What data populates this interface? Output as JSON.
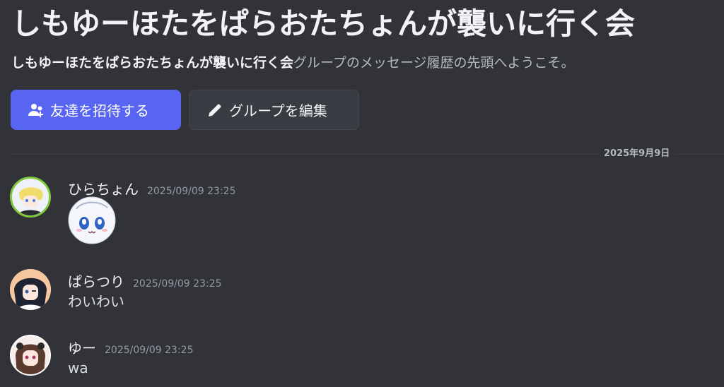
{
  "header": {
    "title": "しもゆーほたをぱらおたちょんが襲いに行く会",
    "subtitle_bold": "しもゆーほたをぱらおたちょんが襲いに行く会",
    "subtitle_rest": "グループのメッセージ履歴の先頭へようこそ。"
  },
  "actions": {
    "invite_label": "友達を招待する",
    "edit_label": "グループを編集"
  },
  "divider": {
    "date": "2025年9月9日"
  },
  "messages": [
    {
      "username": "ひらちょん",
      "timestamp": "2025/09/09 23:25",
      "text": ""
    },
    {
      "username": "ぱらつり",
      "timestamp": "2025/09/09 23:25",
      "text": "わいわい"
    },
    {
      "username": "ゆー",
      "timestamp": "2025/09/09 23:25",
      "text": "wa"
    }
  ],
  "colors": {
    "background": "#313338",
    "primary_button": "#5865f2",
    "secondary_button": "#3a3c43"
  }
}
